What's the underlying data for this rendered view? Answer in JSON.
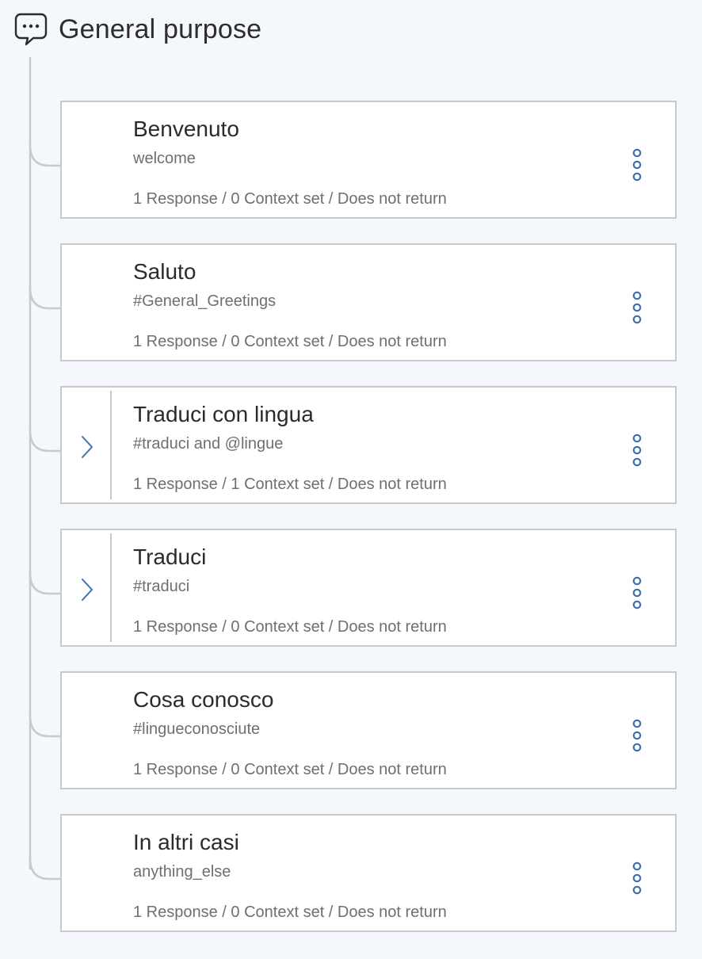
{
  "folder": {
    "title": "General purpose",
    "icon": "chat-bubble-icon"
  },
  "colors": {
    "accent": "#3d70b2",
    "border": "#c7c9cc",
    "tree_line": "#c7c9cc",
    "background": "#f4f7fb"
  },
  "nodes": [
    {
      "title": "Benvenuto",
      "condition": "welcome",
      "meta": "1 Response / 0 Context set / Does not return",
      "has_children": false
    },
    {
      "title": "Saluto",
      "condition": "#General_Greetings",
      "meta": "1 Response / 0 Context set / Does not return",
      "has_children": false
    },
    {
      "title": "Traduci con lingua",
      "condition": "#traduci and @lingue",
      "meta": "1 Response / 1 Context set / Does not return",
      "has_children": true
    },
    {
      "title": "Traduci",
      "condition": "#traduci",
      "meta": "1 Response / 0 Context set / Does not return",
      "has_children": true
    },
    {
      "title": "Cosa conosco",
      "condition": "#lingueconosciute",
      "meta": "1 Response / 0 Context set / Does not return",
      "has_children": false
    },
    {
      "title": "In altri casi",
      "condition": "anything_else",
      "meta": "1 Response / 0 Context set / Does not return",
      "has_children": false
    }
  ]
}
